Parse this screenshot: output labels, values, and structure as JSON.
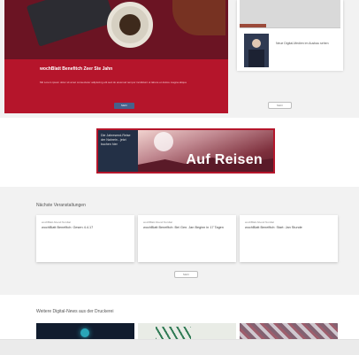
{
  "hero": {
    "title": "wochBlatt Benefitch Zeer Ste Jahn",
    "text": "Mit Lorem ipsum dolor sit amet consectetur adipiscing elit sed do eiusmod tempor incididunt ut labore et dolore magna aliqua",
    "button_label": "Mehr"
  },
  "side_card": {
    "snippet": "Neue Digital-Medien im Ausbau sehen"
  },
  "more_button_label": "Mehr",
  "banner": {
    "left_text": "Die Jahresend-Reise der Nahrein - jetzt buchen hier",
    "title": "Auf Reisen"
  },
  "events": {
    "heading": "Nächste Veranstaltungen",
    "cards": [
      {
        "meta": "wochBlatt Abend Nordtal",
        "title": "wochBlatt Benefitch: Gesen 4.4.17"
      },
      {
        "meta": "wochBlatt Abend Nordtal",
        "title": "wochBlatt Benefitch: Bei Gen. Jan Beginn in 17 Tagen"
      },
      {
        "meta": "wochBlatt Abend Nordtal",
        "title": "wochBlatt Benefitch: Start: Jan Stunde"
      }
    ],
    "more_label": "Mehr"
  },
  "news": {
    "heading": "Weitere Digital-News aus der Druckerei"
  },
  "colors": {
    "accent_red": "#b5152b",
    "button_blue": "#46628c",
    "band_gray": "#f2f2f2"
  }
}
